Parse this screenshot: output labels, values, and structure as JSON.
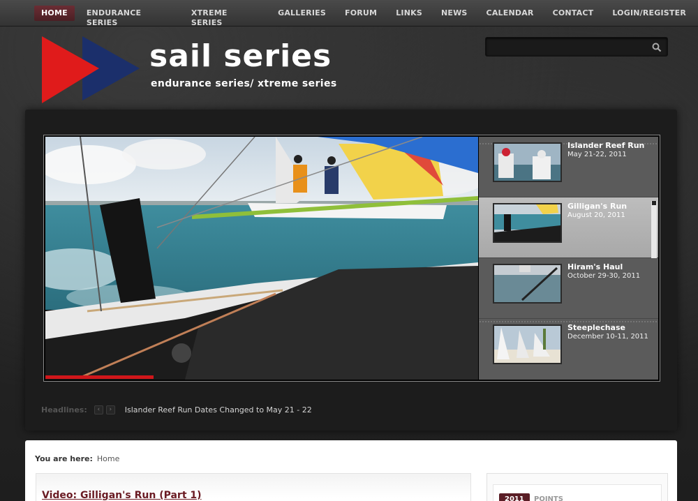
{
  "nav": {
    "items": [
      {
        "label": "HOME",
        "active": true
      },
      {
        "label": "ENDURANCE SERIES"
      },
      {
        "label": "XTREME SERIES"
      },
      {
        "label": "GALLERIES"
      },
      {
        "label": "FORUM"
      },
      {
        "label": "LINKS"
      },
      {
        "label": "NEWS"
      },
      {
        "label": "CALENDAR"
      },
      {
        "label": "CONTACT"
      },
      {
        "label": "LOGIN/REGISTER"
      }
    ]
  },
  "header": {
    "title": "sail series",
    "subtitle": "endurance series/ xtreme series",
    "logo_colors": {
      "red": "#e01b1b",
      "blue": "#1b2f6b"
    }
  },
  "search": {
    "placeholder": "",
    "icon": "search-icon"
  },
  "slideshow": {
    "progress": 0.25,
    "items": [
      {
        "name": "Islander Reef Run",
        "date": "May 21-22, 2011"
      },
      {
        "name": "Gilligan's Run",
        "date": "August 20, 2011",
        "active": true
      },
      {
        "name": "Hiram's Haul",
        "date": "October 29-30, 2011"
      },
      {
        "name": "Steeplechase",
        "date": "December 10-11, 2011"
      }
    ]
  },
  "headlines": {
    "label": "Headlines:",
    "prev": "‹",
    "next": "›",
    "text": "Islander Reef Run Dates Changed to May 21 - 22"
  },
  "breadcrumb": {
    "prefix": "You are here:",
    "current": "Home"
  },
  "article": {
    "title": "Video: Gilligan's Run (Part 1)"
  },
  "sidebar": {
    "year": "2011",
    "points": "POINTS"
  },
  "colors": {
    "accent": "#6a1b23",
    "progress": "#d0161a"
  }
}
